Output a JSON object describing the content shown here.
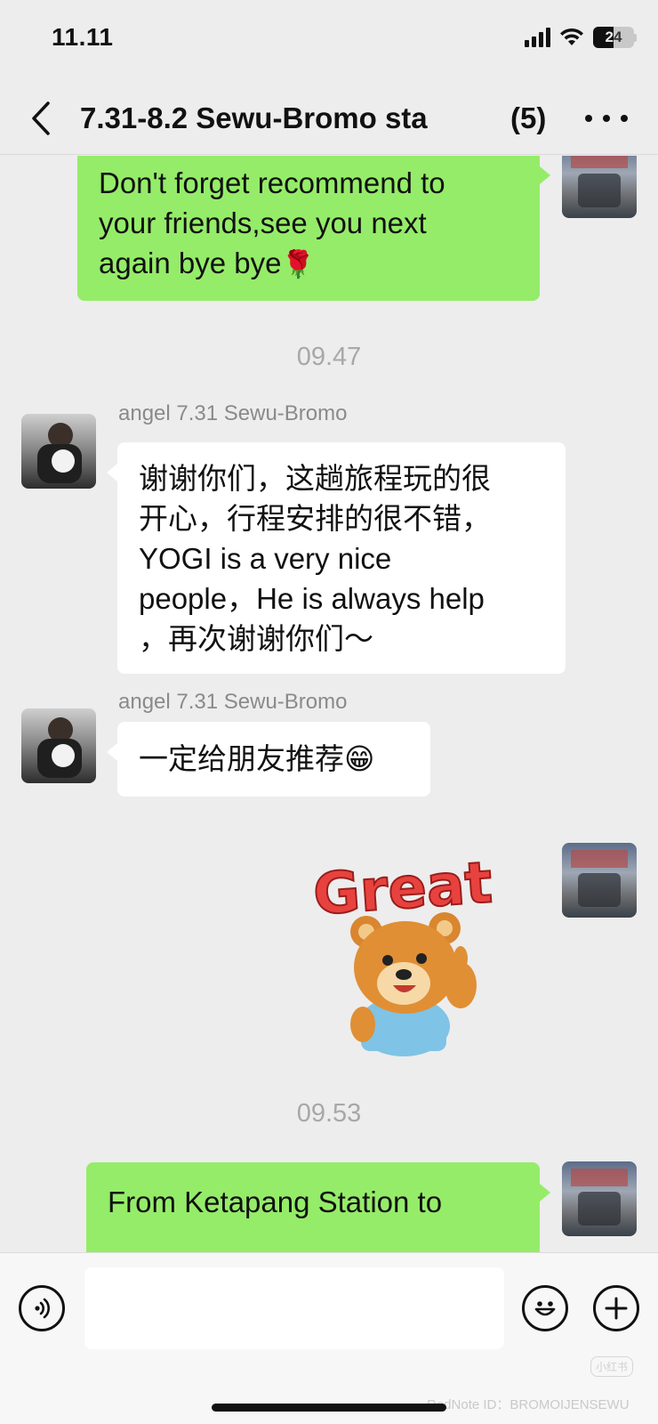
{
  "status_bar": {
    "time": "11.11",
    "battery": "24"
  },
  "header": {
    "title": "7.31-8.2 Sewu-Bromo sta",
    "member_count": "(5)",
    "back_icon": "chevron-left-icon",
    "more_icon": "more-dots-icon"
  },
  "messages": [
    {
      "type": "outgoing",
      "lines": [
        "Don't forget recommend to",
        "your friends,see you next",
        "again bye bye"
      ],
      "emoji": "🌹"
    },
    {
      "type": "timestamp",
      "text": "09.47"
    },
    {
      "type": "incoming",
      "sender": "angel 7.31 Sewu-Bromo",
      "lines": [
        "谢谢你们，这趟旅程玩的很",
        "开心，行程安排的很不错，",
        "YOGI is a very nice",
        "people，He is always help",
        "，再次谢谢你们～"
      ]
    },
    {
      "type": "incoming",
      "sender": "angel 7.31 Sewu-Bromo",
      "text": "一定给朋友推荐",
      "emoji": "😁"
    },
    {
      "type": "outgoing-sticker",
      "sticker_text": "Great",
      "sticker_icon": "bear-thumbs-up-icon"
    },
    {
      "type": "timestamp",
      "text": "09.53"
    },
    {
      "type": "outgoing",
      "lines": [
        "From Ketapang Station to"
      ]
    }
  ],
  "input_bar": {
    "voice_icon": "voice-icon",
    "emoji_icon": "emoji-icon",
    "plus_icon": "plus-icon",
    "input_value": ""
  },
  "watermark": {
    "text": "小红书",
    "note_id": "RedNote ID：BROMOIJENSEWU"
  },
  "colors": {
    "background": "#ededed",
    "outgoing_bubble": "#95ec69",
    "incoming_bubble": "#ffffff",
    "timestamp_text": "#a8a8a8"
  }
}
